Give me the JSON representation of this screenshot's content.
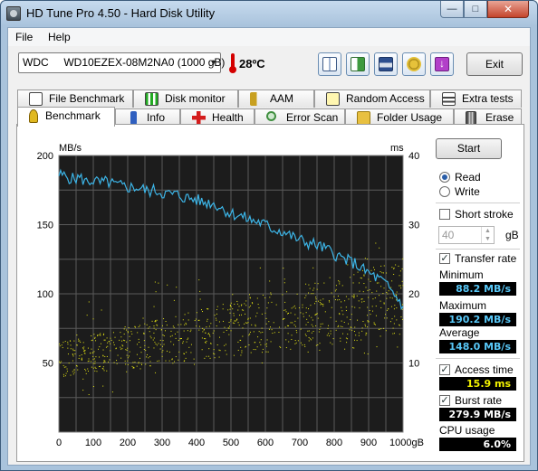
{
  "window": {
    "title": "HD Tune Pro 4.50 - Hard Disk Utility",
    "min_glyph": "—",
    "max_glyph": "□",
    "close_glyph": "✕"
  },
  "menu": {
    "file": "File",
    "help": "Help"
  },
  "toolbar": {
    "drive": "WDC     WD10EZEX-08M2NA0 (1000 gB)",
    "temperature": "28ºC",
    "exit_label": "Exit",
    "icons": [
      "copy-info-icon",
      "copy-screenshot-icon",
      "save-icon",
      "options-icon",
      "hard-drive-arrow-icon"
    ]
  },
  "tabs_row1": [
    "File Benchmark",
    "Disk monitor",
    "AAM",
    "Random Access",
    "Extra tests"
  ],
  "tabs_row2": [
    "Benchmark",
    "Info",
    "Health",
    "Error Scan",
    "Folder Usage",
    "Erase"
  ],
  "active_tab": "Benchmark",
  "side": {
    "start_label": "Start",
    "read_label": "Read",
    "write_label": "Write",
    "read_selected": true,
    "short_stroke_label": "Short stroke",
    "short_stroke_checked": false,
    "short_stroke_value": "40",
    "short_stroke_unit": "gB",
    "transfer_rate_label": "Transfer rate",
    "transfer_rate_checked": true,
    "minimum_label": "Minimum",
    "minimum_value": "88.2 MB/s",
    "maximum_label": "Maximum",
    "maximum_value": "190.2 MB/s",
    "average_label": "Average",
    "average_value": "148.0 MB/s",
    "access_time_label": "Access time",
    "access_time_checked": true,
    "access_time_value": "15.9 ms",
    "burst_rate_label": "Burst rate",
    "burst_rate_checked": true,
    "burst_rate_value": "279.9 MB/s",
    "cpu_label": "CPU usage",
    "cpu_value": "6.0%"
  },
  "chart_data": {
    "type": "line",
    "left_unit": "MB/s",
    "right_unit": "ms",
    "x_ticks": [
      "0",
      "100",
      "200",
      "300",
      "400",
      "500",
      "600",
      "700",
      "800",
      "900",
      "1000gB"
    ],
    "y_left_ticks": [
      "200",
      "150",
      "100",
      "50"
    ],
    "y_right_ticks": [
      "40",
      "30",
      "20",
      "10"
    ],
    "xlim": [
      0,
      1000
    ],
    "ylim_left": [
      0,
      200
    ],
    "ylim_right": [
      0,
      40
    ],
    "grid": true,
    "colors": {
      "background": "#1c1c1c",
      "grid": "#5a5a5a",
      "transfer": "#3cb4e6",
      "access": "#e6e614"
    },
    "series": [
      {
        "name": "Transfer rate",
        "axis": "left",
        "x": [
          0,
          20,
          40,
          60,
          80,
          100,
          120,
          140,
          160,
          180,
          200,
          220,
          240,
          260,
          280,
          300,
          320,
          340,
          360,
          380,
          400,
          420,
          440,
          460,
          480,
          500,
          520,
          540,
          560,
          580,
          600,
          620,
          640,
          660,
          680,
          700,
          720,
          740,
          760,
          780,
          800,
          820,
          840,
          860,
          880,
          900,
          920,
          940,
          960,
          980,
          1000
        ],
        "values": [
          186,
          185,
          183,
          184,
          181,
          182,
          180,
          181,
          179,
          178,
          177,
          177,
          176,
          174,
          175,
          173,
          172,
          172,
          170,
          169,
          168,
          166,
          166,
          164,
          161,
          158,
          157,
          155,
          153,
          152,
          150,
          147,
          146,
          144,
          141,
          139,
          137,
          136,
          134,
          132,
          129,
          126,
          124,
          122,
          118,
          115,
          112,
          109,
          104,
          98,
          91
        ]
      },
      {
        "name": "Access time",
        "axis": "right",
        "x_range": [
          0,
          1000
        ],
        "trend_low_ms": [
          8,
          14
        ],
        "trend_high_ms": [
          13,
          25
        ]
      }
    ]
  }
}
